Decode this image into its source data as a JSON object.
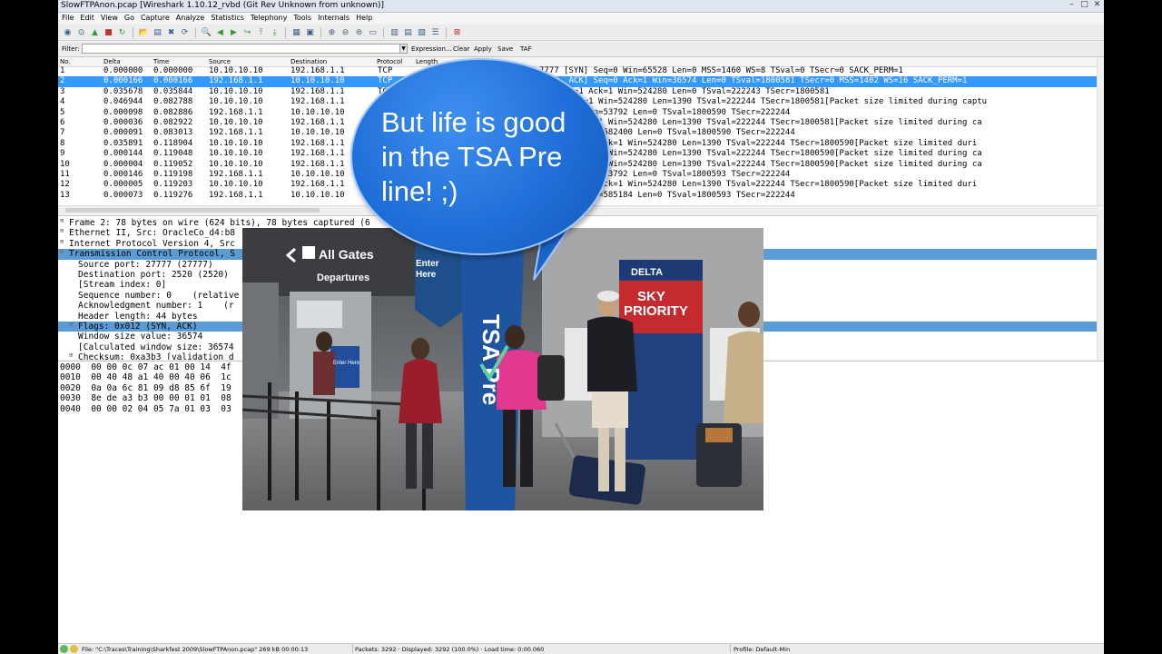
{
  "window": {
    "title": "SlowFTPAnon.pcap  [Wireshark 1.10.12_rvbd  (Git Rev Unknown from unknown)]"
  },
  "menu": [
    "File",
    "Edit",
    "View",
    "Go",
    "Capture",
    "Analyze",
    "Statistics",
    "Telephony",
    "Tools",
    "Internals",
    "Help"
  ],
  "filter": {
    "label": "Filter:",
    "value": "",
    "buttons": [
      "Expression...",
      "Clear",
      "Apply",
      "Save",
      "TAF"
    ]
  },
  "packet_list": {
    "columns": [
      "No.",
      "Delta",
      "Time",
      "Source",
      "Destination",
      "Protocol",
      "Length"
    ],
    "rows": [
      {
        "no": "1",
        "delta": "0.000000",
        "time": "0.000000",
        "src": "10.10.10.10",
        "dst": "192.168.1.1",
        "proto": "TCP",
        "info": "7777 [SYN] Seq=0 Win=65528 Len=0 MSS=1460 WS=8 TSval=0 TSecr=0 SACK_PERM=1"
      },
      {
        "no": "2",
        "delta": "0.000166",
        "time": "0.000166",
        "src": "192.168.1.1",
        "dst": "10.10.10.10",
        "proto": "TCP",
        "info": "[SYN, ACK] Seq=0 Ack=1 Win=36574 Len=0 TSval=1800581 TSecr=0 MSS=1402 WS=16 SACK_PERM=1"
      },
      {
        "no": "3",
        "delta": "0.035678",
        "time": "0.035844",
        "src": "10.10.10.10",
        "dst": "192.168.1.1",
        "proto": "TCP",
        "info": "CK] Seq=1 Ack=1 Win=524280 Len=0 TSval=222243 TSecr=1800581"
      },
      {
        "no": "4",
        "delta": "0.046944",
        "time": "0.082788",
        "src": "10.10.10.10",
        "dst": "192.168.1.1",
        "proto": "TCP",
        "info": "Seq=1 Ack=1 Win=524280 Len=1390 TSval=222244 TSecr=1800581[Packet size limited during captu"
      },
      {
        "no": "5",
        "delta": "0.000098",
        "time": "0.082886",
        "src": "192.168.1.1",
        "dst": "10.10.10.10",
        "proto": "TCP",
        "info": "Ack=1391 Win=53792 Len=0 TSval=1800590 TSecr=222244"
      },
      {
        "no": "6",
        "delta": "0.000036",
        "time": "0.082922",
        "src": "10.10.10.10",
        "dst": "192.168.1.1",
        "proto": "TCP",
        "info": "eq=1391 Ack=1 Win=524280 Len=1390 TSval=222244 TSecr=1800581[Packet size limited during ca"
      },
      {
        "no": "7",
        "delta": "0.000091",
        "time": "0.083013",
        "src": "192.168.1.1",
        "dst": "10.10.10.10",
        "proto": "TCP",
        "info": "Ack=2781 Win=582400 Len=0 TSval=1800590 TSecr=222244"
      },
      {
        "no": "8",
        "delta": "0.035891",
        "time": "0.118904",
        "src": "10.10.10.10",
        "dst": "192.168.1.1",
        "proto": "TCP",
        "info": "K] Seq=2781 Ack=1 Win=524280 Len=1390 TSval=222244 TSecr=1800590[Packet size limited duri"
      },
      {
        "no": "9",
        "delta": "0.000144",
        "time": "0.119048",
        "src": "10.10.10.10",
        "dst": "192.168.1.1",
        "proto": "TCP",
        "info": "eq=4171 Ack=1 Win=524280 Len=1390 TSval=222244 TSecr=1800590[Packet size limited during ca"
      },
      {
        "no": "10",
        "delta": "0.000004",
        "time": "0.119052",
        "src": "10.10.10.10",
        "dst": "192.168.1.1",
        "proto": "TCP",
        "info": "eq=5561 Ack=1 Win=524280 Len=1390 TSval=222244 TSecr=1800590[Packet size limited during ca"
      },
      {
        "no": "11",
        "delta": "0.000146",
        "time": "0.119198",
        "src": "192.168.1.1",
        "dst": "10.10.10.10",
        "proto": "TCP",
        "info": "Ack=5561 Win=53792 Len=0 TSval=1800593 TSecr=222244"
      },
      {
        "no": "12",
        "delta": "0.000005",
        "time": "0.119203",
        "src": "10.10.10.10",
        "dst": "192.168.1.1",
        "proto": "TCP",
        "info": "K] Seq=6951 Ack=1 Win=524280 Len=1390 TSval=222244 TSecr=1800590[Packet size limited duri"
      },
      {
        "no": "13",
        "delta": "0.000073",
        "time": "0.119276",
        "src": "192.168.1.1",
        "dst": "10.10.10.10",
        "proto": "TCP",
        "info": "Ack=8341 Win=585184 Len=0 TSval=1800593 TSecr=222244"
      }
    ]
  },
  "details": [
    {
      "text": "Frame 2: 78 bytes on wire (624 bits), 78 bytes captured (6",
      "indent": 0,
      "expander": "+"
    },
    {
      "text": "Ethernet II, Src: OracleCo_d4:b8",
      "indent": 0,
      "expander": "+"
    },
    {
      "text": "Internet Protocol Version 4, Src",
      "indent": 0,
      "expander": "+"
    },
    {
      "text": "Transmission Control Protocol, S",
      "indent": 0,
      "expander": "-"
    },
    {
      "text": "Source port: 27777 (27777)",
      "indent": 1,
      "expander": ""
    },
    {
      "text": "Destination port: 2520 (2520)",
      "indent": 1,
      "expander": ""
    },
    {
      "text": "[Stream index: 0]",
      "indent": 1,
      "expander": ""
    },
    {
      "text": "Sequence number: 0    (relative",
      "indent": 1,
      "expander": ""
    },
    {
      "text": "Acknowledgment number: 1    (r",
      "indent": 1,
      "expander": ""
    },
    {
      "text": "Header length: 44 bytes",
      "indent": 1,
      "expander": ""
    },
    {
      "text": "Flags: 0x012 (SYN, ACK)",
      "indent": 1,
      "expander": "+"
    },
    {
      "text": "Window size value: 36574",
      "indent": 1,
      "expander": ""
    },
    {
      "text": "[Calculated window size: 36574",
      "indent": 1,
      "expander": ""
    },
    {
      "text": "Checksum: 0xa3b3 [validation d",
      "indent": 1,
      "expander": "+"
    }
  ],
  "hex_lines": [
    "0000  00 00 0c 07 ac 01 00 14  4f",
    "0010  00 40 48 a1 40 00 40 06  1c",
    "0020  0a 0a 6c 81 09 d8 85 6f  19",
    "0030  8e de a3 b3 00 00 01 01  08",
    "0040  00 00 02 04 05 7a 01 03  03"
  ],
  "status": {
    "file": "File: \"C:\\Traces\\Training\\Sharkfest 2009\\SlowFTPAnon.pcap\" 269 kB 00:00:13",
    "packets": "Packets: 3292 · Displayed: 3292 (100.0%) · Load time: 0:00.060",
    "profile": "Profile: Default-Min"
  },
  "overlay": {
    "bubble_text": "But life is good\nin the TSA Pre\nline! ;)",
    "photo_signs": {
      "gates": "All Gates",
      "departures": "Departures",
      "enter_here": "Enter\nHere",
      "tsa_banner": "TSA Pre",
      "delta": "DELTA",
      "sky_priority": "SKY\nPRIORITY",
      "enter_here_small": "Enter Here"
    }
  },
  "colors": {
    "selection": "#3399ff",
    "tcp_highlight": "#5b9bd5",
    "bubble": "#1f6fd8"
  }
}
